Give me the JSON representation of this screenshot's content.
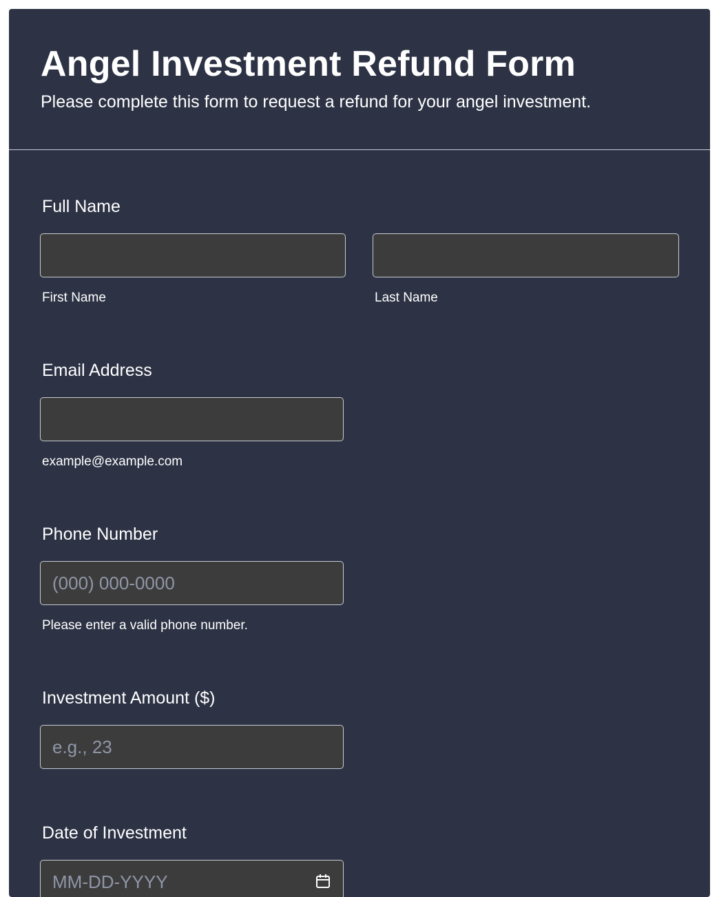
{
  "form": {
    "title": "Angel Investment Refund Form",
    "subtitle": "Please complete this form to request a refund for your angel investment."
  },
  "fields": {
    "full_name": {
      "label": "Full Name",
      "first_sublabel": "First Name",
      "last_sublabel": "Last Name",
      "first_value": "",
      "last_value": ""
    },
    "email": {
      "label": "Email Address",
      "value": "",
      "sublabel": "example@example.com"
    },
    "phone": {
      "label": "Phone Number",
      "placeholder": "(000) 000-0000",
      "sublabel": "Please enter a valid phone number."
    },
    "amount": {
      "label": "Investment Amount ($)",
      "placeholder": "e.g., 23"
    },
    "date": {
      "label": "Date of Investment",
      "placeholder": "MM-DD-YYYY",
      "icon": "calendar-icon"
    }
  },
  "colors": {
    "card_background": "#2d3345",
    "input_background": "#3c3c3c",
    "input_border": "#c9ccd4",
    "text": "#ffffff",
    "placeholder": "#8f96a8"
  }
}
